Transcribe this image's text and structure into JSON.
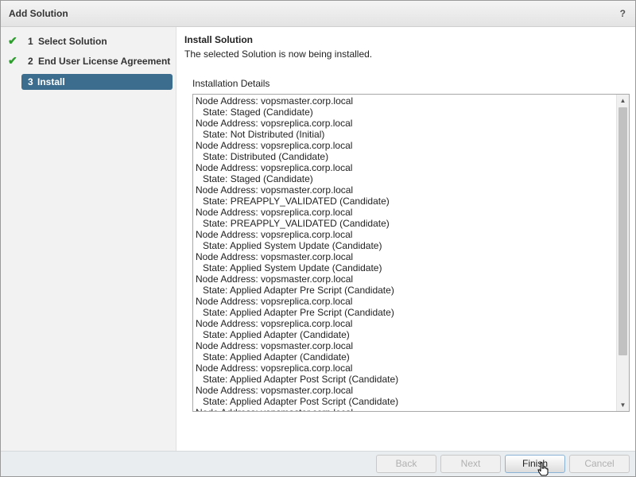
{
  "window": {
    "title": "Add Solution",
    "help_label": "?"
  },
  "wizard": {
    "steps": [
      {
        "number": "1",
        "label": "Select Solution",
        "state": "completed"
      },
      {
        "number": "2",
        "label": "End User License Agreement",
        "state": "completed"
      },
      {
        "number": "3",
        "label": "Install",
        "state": "active"
      }
    ]
  },
  "content": {
    "heading": "Install Solution",
    "subheading": "The selected Solution is now being installed.",
    "details_label": "Installation Details",
    "log_lines": [
      "Node Address: vopsmaster.corp.local",
      "State: Staged (Candidate)",
      "Node Address: vopsreplica.corp.local",
      "State: Not Distributed (Initial)",
      "Node Address: vopsreplica.corp.local",
      "State: Distributed (Candidate)",
      "Node Address: vopsreplica.corp.local",
      "State: Staged (Candidate)",
      "Node Address: vopsmaster.corp.local",
      "State: PREAPPLY_VALIDATED (Candidate)",
      "Node Address: vopsreplica.corp.local",
      "State: PREAPPLY_VALIDATED (Candidate)",
      "Node Address: vopsreplica.corp.local",
      "State: Applied System Update (Candidate)",
      "Node Address: vopsmaster.corp.local",
      "State: Applied System Update (Candidate)",
      "Node Address: vopsmaster.corp.local",
      "State: Applied Adapter Pre Script (Candidate)",
      "Node Address: vopsreplica.corp.local",
      "State: Applied Adapter Pre Script (Candidate)",
      "Node Address: vopsreplica.corp.local",
      "State: Applied Adapter (Candidate)",
      "Node Address: vopsmaster.corp.local",
      "State: Applied Adapter (Candidate)",
      "Node Address: vopsreplica.corp.local",
      "State: Applied Adapter Post Script (Candidate)",
      "Node Address: vopsmaster.corp.local",
      "State: Applied Adapter Post Script (Candidate)",
      "Node Address: vopsmaster.corp.local"
    ]
  },
  "footer": {
    "back_label": "Back",
    "next_label": "Next",
    "finish_label": "Finish",
    "cancel_label": "Cancel"
  },
  "colors": {
    "active_step_bg": "#3c6d8f",
    "check_green": "#2e9e2e",
    "footer_bg": "#e9edf0"
  }
}
